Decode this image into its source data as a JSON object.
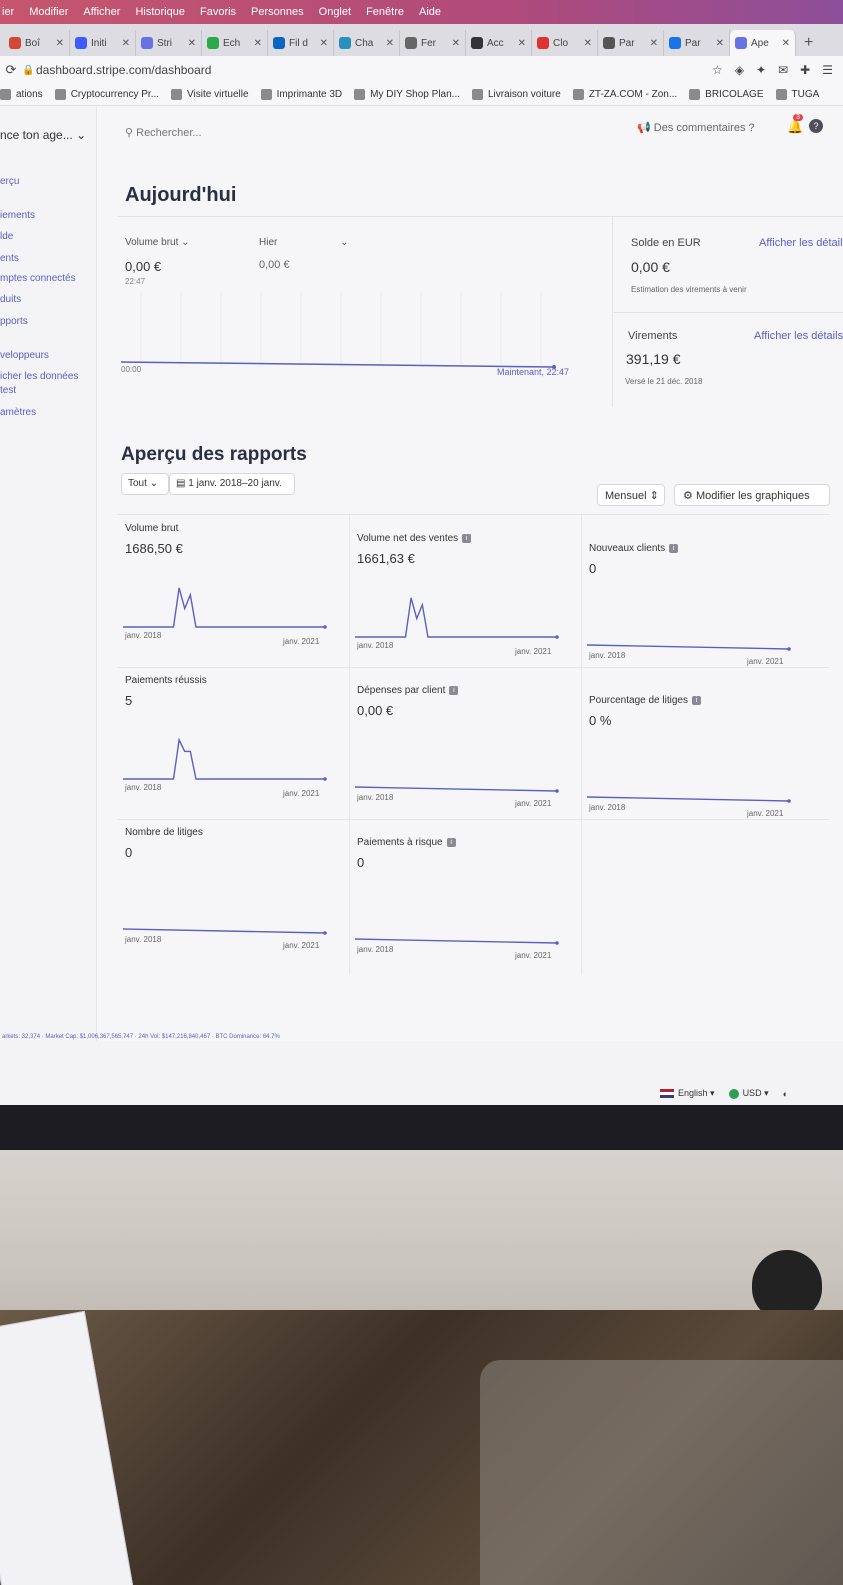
{
  "menubar": [
    "ier",
    "Modifier",
    "Afficher",
    "Historique",
    "Favoris",
    "Personnes",
    "Onglet",
    "Fenêtre",
    "Aide"
  ],
  "tabs": [
    {
      "label": "Boî",
      "color": "#d14836"
    },
    {
      "label": "Initi",
      "color": "#3d5afe"
    },
    {
      "label": "Stri",
      "color": "#6772e5"
    },
    {
      "label": "Ech",
      "color": "#2aa84a"
    },
    {
      "label": "Fil d",
      "color": "#0a66c2"
    },
    {
      "label": "Cha",
      "color": "#2a8fbd"
    },
    {
      "label": "Fer",
      "color": "#666"
    },
    {
      "label": "Acc",
      "color": "#333"
    },
    {
      "label": "Clo",
      "color": "#d33"
    },
    {
      "label": "Par",
      "color": "#555"
    },
    {
      "label": "Par",
      "color": "#1a73e8"
    },
    {
      "label": "Ape",
      "color": "#6772e5"
    }
  ],
  "address": {
    "url": "dashboard.stripe.com/dashboard"
  },
  "bookmarks": [
    "ations",
    "Cryptocurrency Pr...",
    "Visite virtuelle",
    "Imprimante 3D",
    "My DIY Shop Plan...",
    "Livraison voiture",
    "ZT-ZA.COM - Zon...",
    "BRICOLAGE",
    "TUGA"
  ],
  "sidebar": {
    "account": "nce ton age...",
    "items": [
      "erçu",
      "iements",
      "lde",
      "ents",
      "mptes connectés",
      "duits",
      "pports",
      "veloppeurs",
      "icher les données",
      "test",
      "amètres"
    ]
  },
  "topbar": {
    "search_placeholder": "Rechercher...",
    "feedback": "Des commentaires ?",
    "notif_count": "3"
  },
  "today": {
    "title": "Aujourd'hui",
    "gross_label": "Volume brut",
    "gross_value": "0,00 €",
    "gross_time": "22:47",
    "yesterday_label": "Hier",
    "yesterday_value": "0,00 €",
    "chart_start": "00:00",
    "chart_end": "Maintenant, 22:47",
    "balance_label": "Solde en EUR",
    "balance_link": "Afficher les détails",
    "balance_value": "0,00 €",
    "balance_sub": "Estimation des virements à venir",
    "payouts_label": "Virements",
    "payouts_link": "Afficher les détails",
    "payouts_value": "391,19 €",
    "payouts_sub": "Versé le 21 déc. 2018"
  },
  "reports": {
    "title": "Aperçu des rapports",
    "filter_all": "Tout",
    "date_range": "1 janv. 2018–20 janv.",
    "interval": "Mensuel",
    "edit_button": "Modifier les graphiques",
    "cards": [
      {
        "label": "Volume brut",
        "value": "1686,50 €",
        "info": false,
        "start": "janv. 2018",
        "end": "janv. 2021",
        "spark": [
          0,
          0,
          0,
          0,
          0,
          0,
          0,
          0,
          0,
          0,
          0.85,
          0.4,
          0.7,
          0,
          0,
          0,
          0,
          0,
          0,
          0,
          0,
          0,
          0,
          0,
          0,
          0,
          0,
          0,
          0,
          0,
          0,
          0,
          0,
          0,
          0,
          0,
          0
        ]
      },
      {
        "label": "Volume net des ventes",
        "value": "1661,63 €",
        "info": true,
        "start": "janv. 2018",
        "end": "janv. 2021",
        "spark": [
          0,
          0,
          0,
          0,
          0,
          0,
          0,
          0,
          0,
          0,
          0.85,
          0.4,
          0.7,
          0,
          0,
          0,
          0,
          0,
          0,
          0,
          0,
          0,
          0,
          0,
          0,
          0,
          0,
          0,
          0,
          0,
          0,
          0,
          0,
          0,
          0,
          0,
          0
        ]
      },
      {
        "label": "Nouveaux clients",
        "value": "0",
        "info": true,
        "start": "janv. 2018",
        "end": "janv. 2021",
        "spark": []
      },
      {
        "label": "Paiements réussis",
        "value": "5",
        "info": false,
        "start": "janv. 2018",
        "end": "janv. 2021",
        "spark": [
          0,
          0,
          0,
          0,
          0,
          0,
          0,
          0,
          0,
          0,
          0.85,
          0.6,
          0.6,
          0,
          0,
          0,
          0,
          0,
          0,
          0,
          0,
          0,
          0,
          0,
          0,
          0,
          0,
          0,
          0,
          0,
          0,
          0,
          0,
          0,
          0,
          0,
          0
        ]
      },
      {
        "label": "Dépenses par client",
        "value": "0,00 €",
        "info": true,
        "start": "janv. 2018",
        "end": "janv. 2021",
        "spark": []
      },
      {
        "label": "Pourcentage de litiges",
        "value": "0 %",
        "info": true,
        "start": "janv. 2018",
        "end": "janv. 2021",
        "spark": []
      },
      {
        "label": "Nombre de litiges",
        "value": "0",
        "info": false,
        "start": "janv. 2018",
        "end": "janv. 2021",
        "spark": []
      },
      {
        "label": "Paiements à risque",
        "value": "0",
        "info": true,
        "start": "janv. 2018",
        "end": "janv. 2021",
        "spark": []
      }
    ]
  },
  "ticker": "arkets: 32,374 · Market Cap: $1,006,367,565,747 · 24h Vol: $147,216,840,467 · BTC Dominance: 64.7%",
  "footer": {
    "language": "English",
    "currency": "USD"
  },
  "colors": {
    "accent": "#5960c4",
    "line": "#5960c4"
  }
}
